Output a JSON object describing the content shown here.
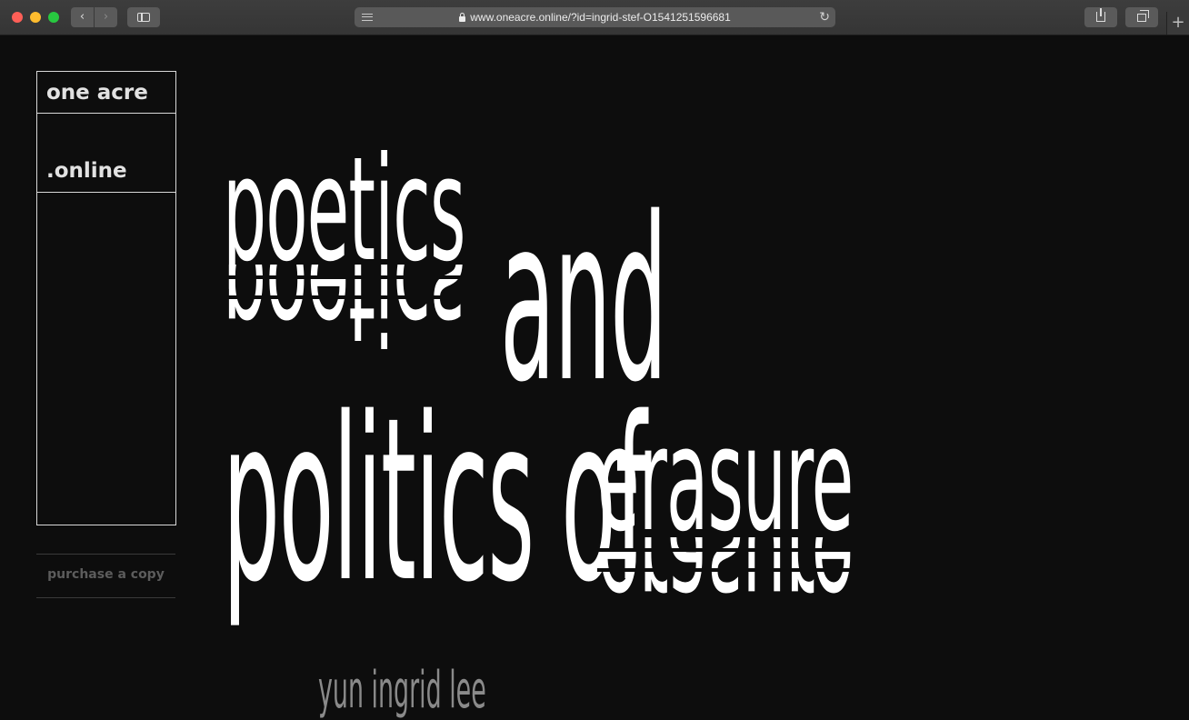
{
  "browser": {
    "url": "www.oneacre.online/?id=ingrid-stef-O1541251596681",
    "back_label": "‹",
    "forward_label": "›",
    "reload_label": "↻",
    "newtab_label": "+"
  },
  "sidebar": {
    "brand_top": "one acre",
    "brand_bottom": ".online",
    "purchase_label": "purchase a copy"
  },
  "title": {
    "word_1": "poetics",
    "word_2": "and",
    "word_3": "politics of",
    "word_4": "erasure",
    "author": "yun ingrid lee"
  },
  "colors": {
    "background": "#0d0d0d",
    "title_text": "#ffffff",
    "brand_text": "#e2e2e2",
    "muted_text": "#5c5c5c",
    "author_text": "#8a8a8a"
  }
}
